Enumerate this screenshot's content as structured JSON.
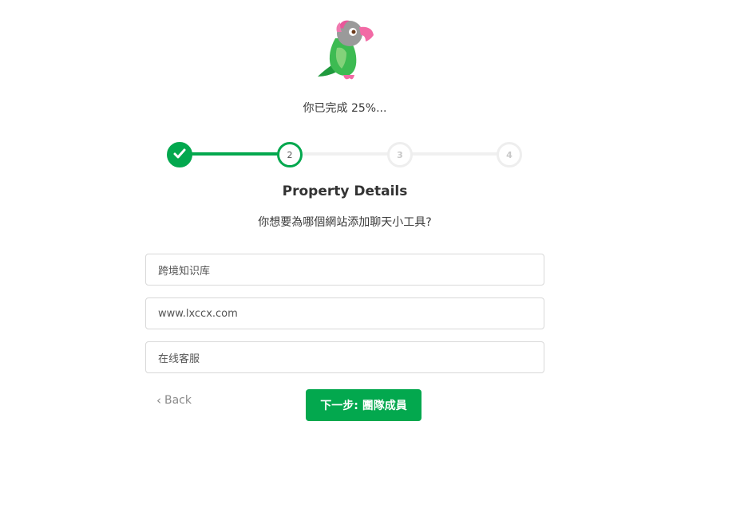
{
  "progress": {
    "text": "你已完成 25%...",
    "percent": 25
  },
  "steps": [
    {
      "number": "1",
      "state": "completed"
    },
    {
      "number": "2",
      "state": "current"
    },
    {
      "number": "3",
      "state": "upcoming"
    },
    {
      "number": "4",
      "state": "upcoming"
    }
  ],
  "form": {
    "title": "Property Details",
    "subtitle": "你想要為哪個網站添加聊天小工具?",
    "fields": [
      {
        "name": "property-name",
        "value": "跨境知识库"
      },
      {
        "name": "website-url",
        "value": "www.lxccx.com"
      },
      {
        "name": "widget-name",
        "value": "在线客服"
      }
    ]
  },
  "actions": {
    "back_label": "Back",
    "next_label": "下一步: 團隊成員"
  },
  "icons": {
    "logo": "parrot-logo-icon",
    "check": "check-icon",
    "back": "chevron-left-icon"
  },
  "colors": {
    "accent": "#03a84e",
    "inactive": "#eeeeee"
  }
}
